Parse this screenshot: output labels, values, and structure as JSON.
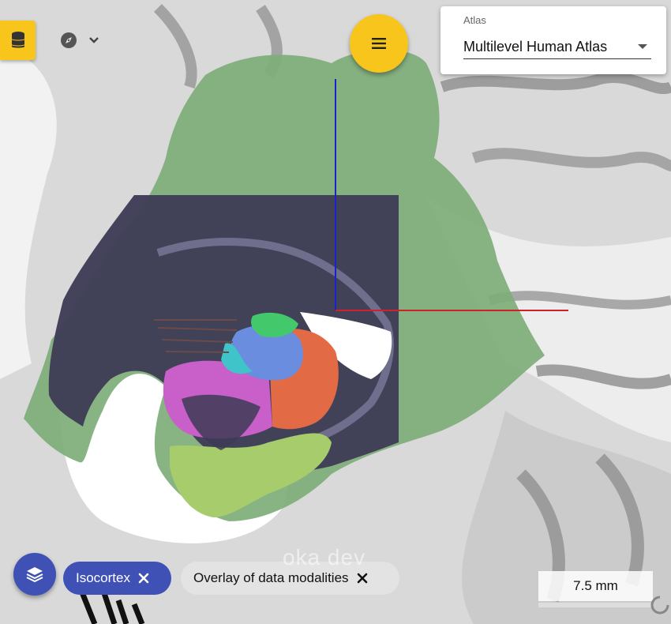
{
  "toolbar": {
    "database_icon": "database-icon",
    "compass_icon": "compass-icon",
    "chevron_icon": "chevron-down-icon",
    "menu_icon": "menu-icon",
    "accent_color": "#f7c51b"
  },
  "atlas": {
    "label": "Atlas",
    "selected": "Multilevel Human Atlas"
  },
  "chips": [
    {
      "label": "Isocortex",
      "icon": "close-icon",
      "color": "#3f51b5"
    },
    {
      "label": "Overlay of data modalities",
      "icon": "close-icon"
    }
  ],
  "layers_icon": "layers-icon",
  "watermark": "oka dev",
  "scale": {
    "label": "7.5 mm"
  },
  "spinner_icon": "spinner-icon"
}
